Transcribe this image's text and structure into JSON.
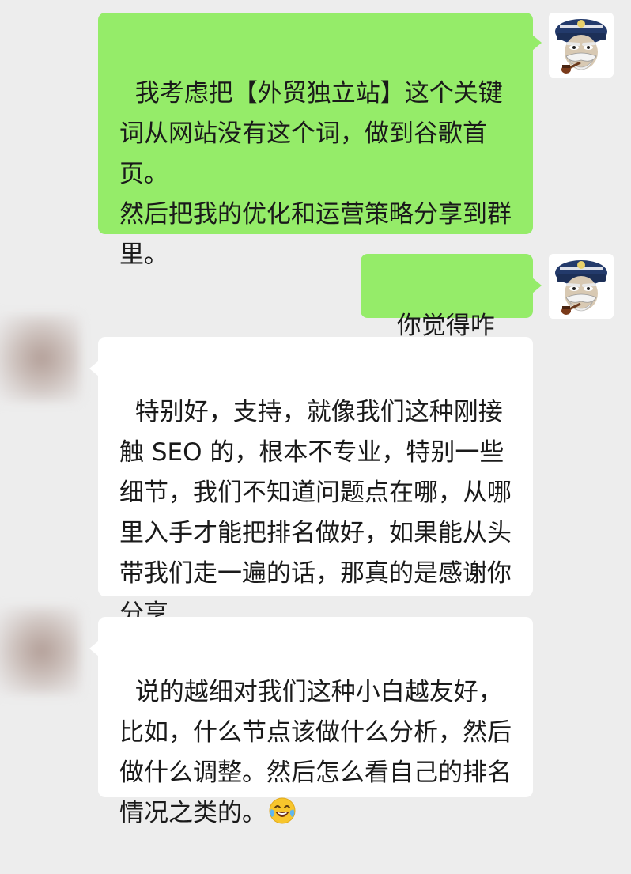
{
  "chat": {
    "messages": [
      {
        "sender": "me",
        "text": "我考虑把【外贸独立站】这个关键词从网站没有这个词，做到谷歌首页。\n然后把我的优化和运营策略分享到群里。"
      },
      {
        "sender": "me",
        "text": "你觉得咋样"
      },
      {
        "sender": "other",
        "text": "特别好，支持，就像我们这种刚接触 SEO 的，根本不专业，特别一些细节，我们不知道问题点在哪，从哪里入手才能把排名做好，如果能从头带我们走一遍的话，那真的是感谢你分享"
      },
      {
        "sender": "other",
        "text": "说的越细对我们这种小白越友好，比如，什么节点该做什么分析，然后做什么调整。然后怎么看自己的排名情况之类的。",
        "emoji": "laughing-tears-emoji"
      }
    ]
  },
  "colors": {
    "background": "#ededed",
    "my_bubble": "#95ec69",
    "other_bubble": "#ffffff",
    "text": "#1a1a1a"
  },
  "avatars": {
    "me": "captain-cartoon-avatar",
    "other": "blurred-avatar"
  }
}
